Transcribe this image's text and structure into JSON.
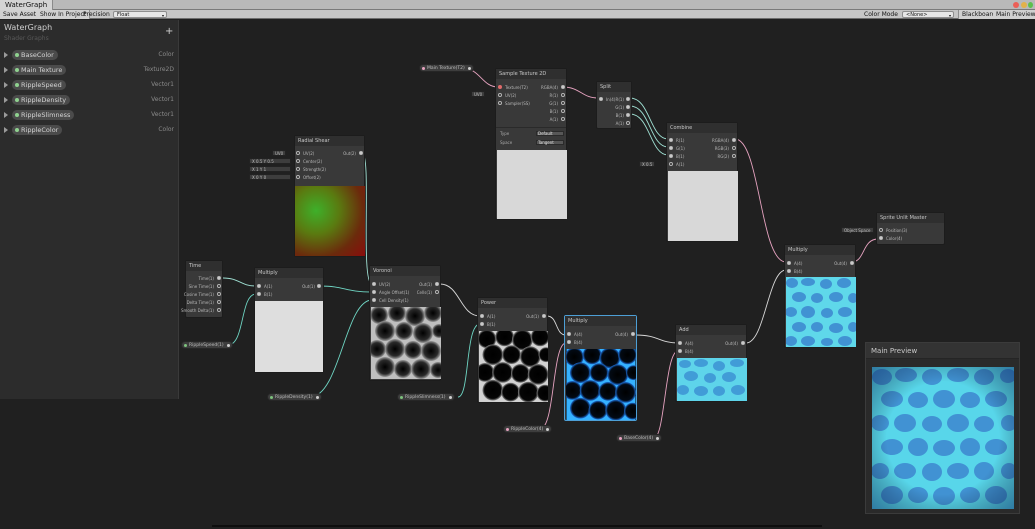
{
  "window": {
    "tab_title": "WaterGraph"
  },
  "toolbar": {
    "save_asset": "Save Asset",
    "show_in_project": "Show In Project",
    "precision_label": "Precision",
    "precision_value": "Float",
    "color_mode_label": "Color Mode",
    "color_mode_value": "<None>",
    "blackboard": "Blackboard",
    "main_preview": "Main Preview"
  },
  "blackboard": {
    "title": "WaterGraph",
    "subtitle": "Shader Graphs",
    "add": "+",
    "properties": [
      {
        "name": "BaseColor",
        "type": "Color"
      },
      {
        "name": "Main Texture",
        "type": "Texture2D"
      },
      {
        "name": "RippleSpeed",
        "type": "Vector1"
      },
      {
        "name": "RippleDensity",
        "type": "Vector1"
      },
      {
        "name": "RippleSlimness",
        "type": "Vector1"
      },
      {
        "name": "RippleColor",
        "type": "Color"
      }
    ]
  },
  "nodes": {
    "time": {
      "title": "Time",
      "outputs": [
        "Time(1)",
        "Sine Time(1)",
        "Cosine Time(1)",
        "Delta Time(1)",
        "Smooth Delta(1)"
      ]
    },
    "multiply1": {
      "title": "Multiply",
      "inputs": [
        "A(1)",
        "B(1)"
      ],
      "output": "Out(1)"
    },
    "radial_shear": {
      "title": "Radial Shear",
      "inputs": [
        "UV(2)",
        "Center(2)",
        "Strength(2)",
        "Offset(2)"
      ],
      "output": "Out(2)",
      "fields": {
        "uv": "UV0",
        "center_x": "0.5",
        "center_y": "0.5",
        "strength_x": "1",
        "strength_y": "1",
        "offset_x": "0",
        "offset_y": "0"
      }
    },
    "voronoi": {
      "title": "Voronoi",
      "inputs": [
        "UV(2)",
        "Angle Offset(1)",
        "Cell Density(1)"
      ],
      "outputs": [
        "Out(1)",
        "Cells(1)"
      ]
    },
    "power": {
      "title": "Power",
      "inputs": [
        "A(1)",
        "B(1)"
      ],
      "output": "Out(1)"
    },
    "multiply2": {
      "title": "Multiply",
      "inputs": [
        "A(4)",
        "B(4)"
      ],
      "output": "Out(4)"
    },
    "add": {
      "title": "Add",
      "inputs": [
        "A(4)",
        "B(4)"
      ],
      "output": "Out(4)"
    },
    "sample_texture": {
      "title": "Sample Texture 2D",
      "inputs": [
        "Texture(T2)",
        "UV(2)",
        "Sampler(SS)"
      ],
      "outputs": [
        "RGBA(4)",
        "R(1)",
        "G(1)",
        "B(1)",
        "A(1)"
      ],
      "type_label": "Type",
      "type_value": "Default",
      "space_label": "Space",
      "space_value": "Tangent",
      "uv_field": "UV0"
    },
    "split": {
      "title": "Split",
      "input": "In(4)",
      "outputs": [
        "R(1)",
        "G(1)",
        "B(1)",
        "A(1)"
      ]
    },
    "combine": {
      "title": "Combine",
      "inputs": [
        "R(1)",
        "G(1)",
        "B(1)",
        "A(1)"
      ],
      "outputs": [
        "RGBA(4)",
        "RGB(3)",
        "RG(2)"
      ],
      "a_field": "0.5"
    },
    "multiply3": {
      "title": "Multiply",
      "inputs": [
        "A(4)",
        "B(4)"
      ],
      "output": "Out(4)"
    },
    "master": {
      "title": "Sprite Unlit Master",
      "inputs": [
        "Position(3)",
        "Color(4)"
      ],
      "space_field": "Object Space"
    }
  },
  "props_on_canvas": {
    "main_texture": "Main Texture(T2)",
    "ripple_speed": "RippleSpeed(1)",
    "ripple_density": "RippleDensity(1)",
    "ripple_slimness": "RippleSlimness(1)",
    "ripple_color": "RippleColor(4)",
    "base_color": "BaseColor(4)"
  },
  "main_preview": {
    "title": "Main Preview"
  },
  "colors": {
    "wire_white": "#d9d9d9",
    "wire_teal": "#6fd6c4",
    "wire_pink": "#e6a3c0",
    "water_light": "#4fd3e6",
    "water_dark": "#3a7fd0"
  }
}
